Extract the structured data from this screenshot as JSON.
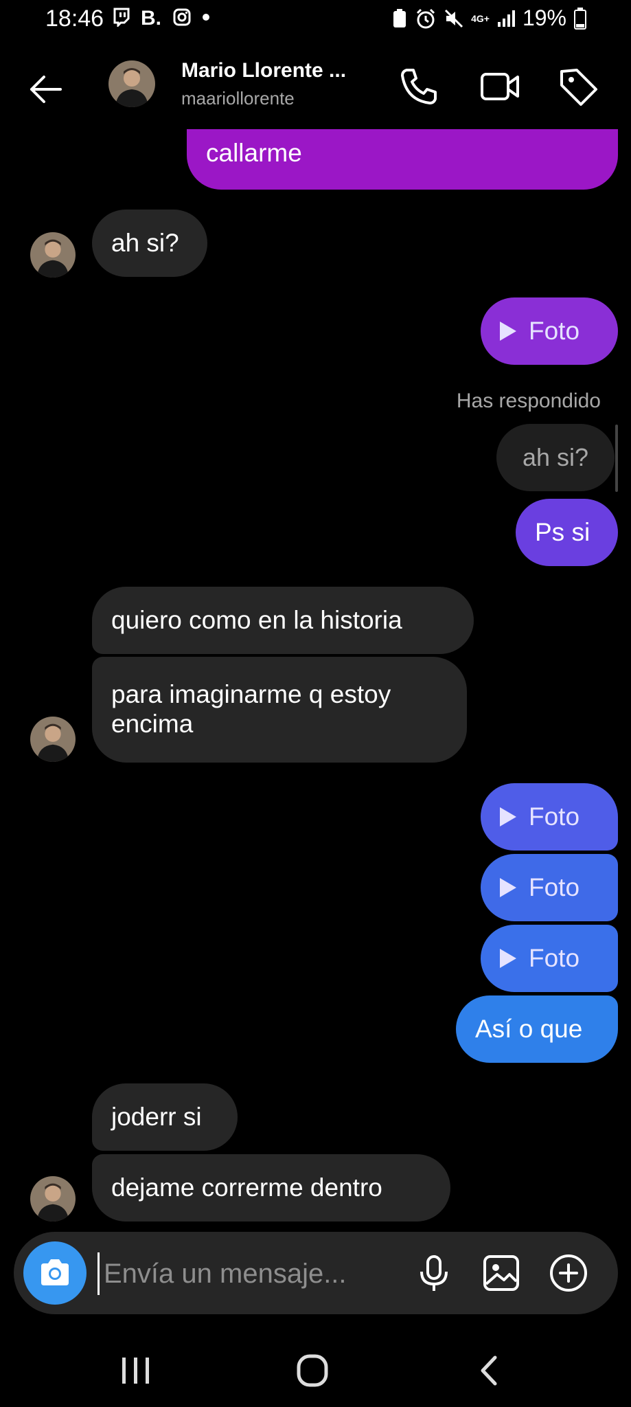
{
  "status_bar": {
    "time": "18:46",
    "battery": "19%",
    "network": "4G+"
  },
  "header": {
    "name": "Mario Llorente ...",
    "username": "maariollorente",
    "icons": [
      "back-arrow-icon",
      "phone-icon",
      "video-camera-icon",
      "tag-icon"
    ]
  },
  "messages": {
    "m1": "callarme",
    "m2": "ah si?",
    "m3": "Foto",
    "reply_label": "Has respondido",
    "reply_quote": "ah si?",
    "m4": "Ps si",
    "m5": "quiero como en la historia",
    "m6": "para imaginarme q estoy encima",
    "m7": "Foto",
    "m8": "Foto",
    "m9": "Foto",
    "m10": "Así o que",
    "m11": "joderr si",
    "m12": "dejame correrme dentro"
  },
  "composer": {
    "placeholder": "Envía un mensaje...",
    "icons": [
      "camera-icon",
      "microphone-icon",
      "image-icon",
      "plus-circle-icon"
    ]
  },
  "colors": {
    "incoming": "#262626",
    "out_purple_top": "#9b17c6",
    "out_purple": "#8a2fd6",
    "out_violet": "#6a3fe0",
    "out_blue": "#4f5de8",
    "out_blue_2": "#3f6ae8",
    "out_blue_3": "#3a70ea",
    "out_blue_4": "#2f80ea",
    "camera_blue": "#3797f0"
  }
}
